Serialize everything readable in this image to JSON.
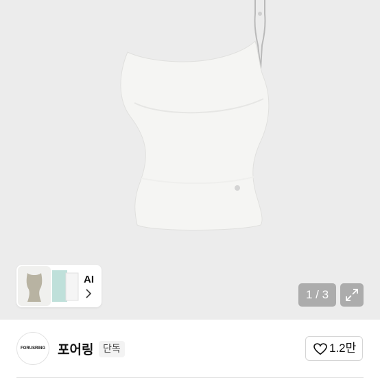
{
  "gallery": {
    "counter": "1 / 3",
    "ai_label": "AI",
    "icons": {
      "expand": "expand-icon",
      "chevron": "chevron-right-icon"
    }
  },
  "seller": {
    "logo_text": "FORUSRING",
    "name": "포어링",
    "badge": "단독"
  },
  "like": {
    "count": "1.2만",
    "icon": "heart-outline-icon"
  },
  "colors": {
    "image_bg": "#ececec",
    "overlay": "rgba(120,120,120,0.55)",
    "text": "#111111"
  }
}
